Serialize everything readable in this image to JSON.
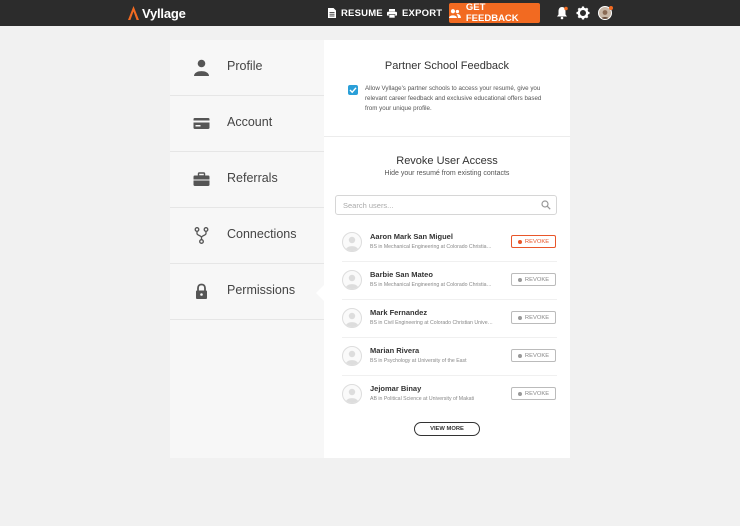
{
  "app": {
    "name": "Vyllage"
  },
  "topbar": {
    "resume_label": "RESUME",
    "export_label": "EXPORT",
    "feedback_label": "GET FEEDBACK",
    "accent": "#f26a21"
  },
  "sidebar": {
    "items": [
      {
        "label": "Profile",
        "icon": "person-icon"
      },
      {
        "label": "Account",
        "icon": "credit-card-icon"
      },
      {
        "label": "Referrals",
        "icon": "briefcase-icon"
      },
      {
        "label": "Connections",
        "icon": "fork-icon"
      },
      {
        "label": "Permissions",
        "icon": "lock-icon",
        "active": true
      }
    ]
  },
  "partner": {
    "title": "Partner School Feedback",
    "checked": true,
    "text": "Allow Vyllage's partner schools to access your resumé, give you relevant career feedback and exclusive educational offers based from your unique profile."
  },
  "revoke": {
    "title": "Revoke User Access",
    "subtitle": "Hide your resumé from existing contacts",
    "search_placeholder": "Search users...",
    "button_label": "REVOKE",
    "users": [
      {
        "name": "Aaron Mark San Miguel",
        "desc": "BS in Mechanical Engineering at Colorado Christian University",
        "highlighted": true
      },
      {
        "name": "Barbie San Mateo",
        "desc": "BS in Mechanical Engineering at Colorado Christian University",
        "highlighted": false
      },
      {
        "name": "Mark Fernandez",
        "desc": "BS in Civil Engineering at Colorado Christian University",
        "highlighted": false
      },
      {
        "name": "Marian Rivera",
        "desc": "BS in Psychology at University of the East",
        "highlighted": false
      },
      {
        "name": "Jejomar Binay",
        "desc": "AB in Political Science at University of Makati",
        "highlighted": false
      }
    ],
    "view_more_label": "VIEW MORE"
  }
}
